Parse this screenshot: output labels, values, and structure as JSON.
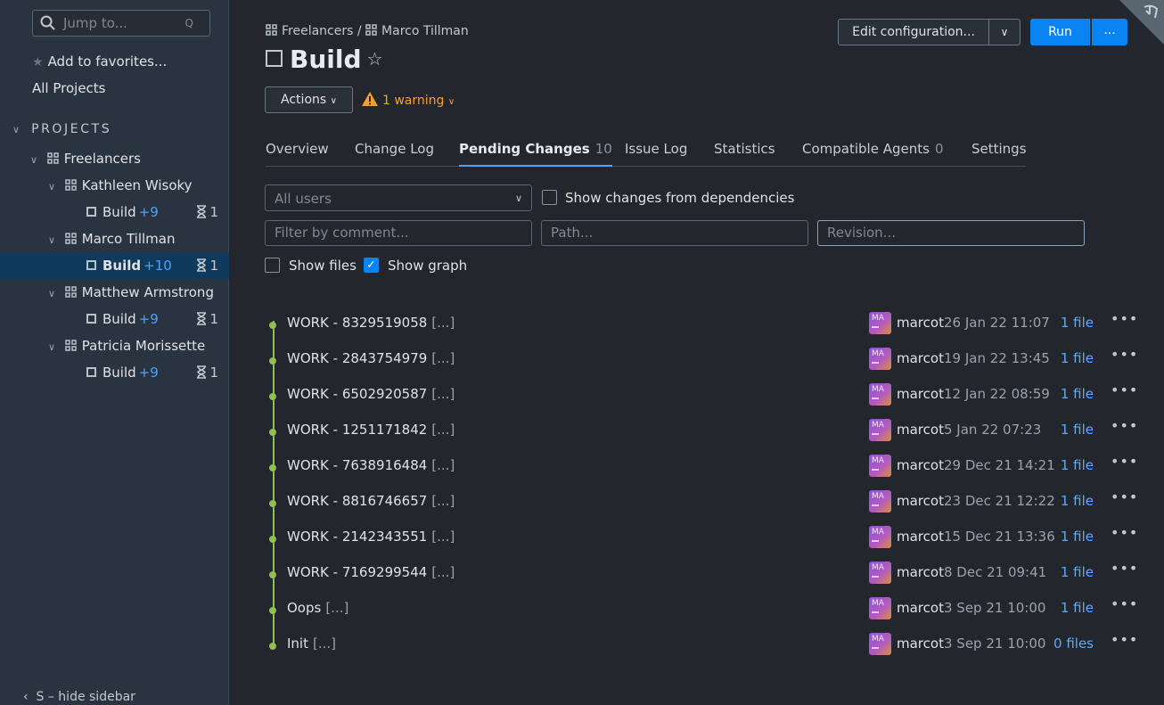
{
  "sidebar": {
    "search_placeholder": "Jump to...",
    "search_shortcut": "Q",
    "add_favorites": "Add to favorites...",
    "all_projects": "All Projects",
    "projects_header": "PROJECTS",
    "root": {
      "name": "Freelancers"
    },
    "projects": [
      {
        "name": "Kathleen Wisoky",
        "build": "Build",
        "plus": "+9",
        "queue": "1"
      },
      {
        "name": "Marco Tillman",
        "build": "Build",
        "plus": "+10",
        "queue": "1"
      },
      {
        "name": "Matthew Armstrong",
        "build": "Build",
        "plus": "+9",
        "queue": "1"
      },
      {
        "name": "Patricia Morissette",
        "build": "Build",
        "plus": "+9",
        "queue": "1"
      }
    ],
    "hide_sidebar": "S – hide sidebar"
  },
  "breadcrumb": {
    "parent": "Freelancers",
    "sep": "/",
    "current": "Marco Tillman"
  },
  "title": "Build",
  "actions_label": "Actions",
  "warning_label": "1 warning",
  "toolbar": {
    "edit_config": "Edit configuration...",
    "run": "Run",
    "run_more": "..."
  },
  "tabs": [
    {
      "label": "Overview",
      "count": ""
    },
    {
      "label": "Change Log",
      "count": ""
    },
    {
      "label": "Pending Changes",
      "count": "10"
    },
    {
      "label": "Issue Log",
      "count": ""
    },
    {
      "label": "Statistics",
      "count": ""
    },
    {
      "label": "Compatible Agents",
      "count": "0"
    },
    {
      "label": "Settings",
      "count": ""
    }
  ],
  "filters": {
    "users_value": "All users",
    "show_deps": "Show changes from dependencies",
    "comment_placeholder": "Filter by comment...",
    "path_placeholder": "Path...",
    "revision_placeholder": "Revision...",
    "show_files": "Show files",
    "show_graph": "Show graph"
  },
  "changes": [
    {
      "msg": "WORK - 8329519058",
      "more": "[...]",
      "avatar": "MA",
      "user": "marcot",
      "date": "26 Jan 22 11:07",
      "files": "1 file"
    },
    {
      "msg": "WORK - 2843754979",
      "more": "[...]",
      "avatar": "MA",
      "user": "marcot",
      "date": "19 Jan 22 13:45",
      "files": "1 file"
    },
    {
      "msg": "WORK - 6502920587",
      "more": "[...]",
      "avatar": "MA",
      "user": "marcot",
      "date": "12 Jan 22 08:59",
      "files": "1 file"
    },
    {
      "msg": "WORK - 1251171842",
      "more": "[...]",
      "avatar": "MA",
      "user": "marcot",
      "date": "5 Jan 22 07:23",
      "files": "1 file"
    },
    {
      "msg": "WORK - 7638916484",
      "more": "[...]",
      "avatar": "MA",
      "user": "marcot",
      "date": "29 Dec 21 14:21",
      "files": "1 file"
    },
    {
      "msg": "WORK - 8816746657",
      "more": "[...]",
      "avatar": "MA",
      "user": "marcot",
      "date": "23 Dec 21 12:22",
      "files": "1 file"
    },
    {
      "msg": "WORK - 2142343551",
      "more": "[...]",
      "avatar": "MA",
      "user": "marcot",
      "date": "15 Dec 21 13:36",
      "files": "1 file"
    },
    {
      "msg": "WORK - 7169299544",
      "more": "[...]",
      "avatar": "MA",
      "user": "marcot",
      "date": "8 Dec 21 09:41",
      "files": "1 file"
    },
    {
      "msg": "Oops",
      "more": "[...]",
      "avatar": "MA",
      "user": "marcot",
      "date": "3 Sep 21 10:00",
      "files": "1 file"
    },
    {
      "msg": "Init",
      "more": "[...]",
      "avatar": "MA",
      "user": "marcot",
      "date": "3 Sep 21 10:00",
      "files": "0 files"
    }
  ],
  "colors": {
    "accent": "#0b84f3",
    "graph": "#8fbf4c",
    "warning": "#f2a22c",
    "link": "#5aaaff"
  }
}
